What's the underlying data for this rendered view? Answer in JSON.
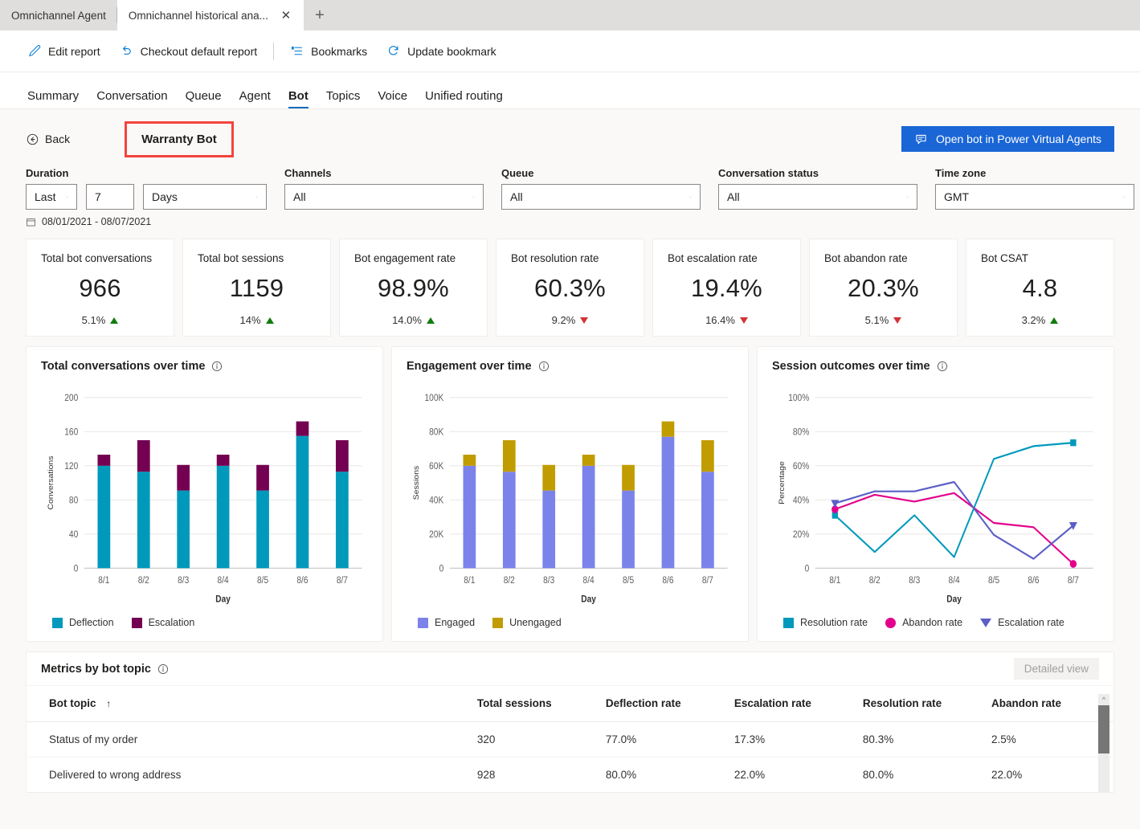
{
  "browser": {
    "tabs": [
      {
        "label": "Omnichannel Agent",
        "active": false
      },
      {
        "label": "Omnichannel historical ana...",
        "active": true
      }
    ],
    "close_glyph": "✕",
    "newtab_glyph": "+"
  },
  "commandbar": {
    "items": [
      {
        "label": "Edit report",
        "icon": "pencil-icon"
      },
      {
        "label": "Checkout default report",
        "icon": "undo-icon"
      },
      {
        "label": "Bookmarks",
        "icon": "bookmarks-list-icon"
      },
      {
        "label": "Update bookmark",
        "icon": "refresh-icon"
      }
    ]
  },
  "pivot": {
    "tabs": [
      "Summary",
      "Conversation",
      "Queue",
      "Agent",
      "Bot",
      "Topics",
      "Voice",
      "Unified routing"
    ],
    "selected": "Bot"
  },
  "header": {
    "back_label": "Back",
    "bot_name": "Warranty Bot",
    "highlight_color": "#f4433e",
    "pva_button_label": "Open bot in Power Virtual Agents",
    "pva_button_color": "#1a66d6"
  },
  "filters": {
    "duration": {
      "label": "Duration",
      "relative": "Last",
      "amount": "7",
      "unit": "Days",
      "range_text": "08/01/2021 - 08/07/2021"
    },
    "channels": {
      "label": "Channels",
      "value": "All"
    },
    "queue": {
      "label": "Queue",
      "value": "All"
    },
    "conversation_status": {
      "label": "Conversation status",
      "value": "All"
    },
    "time_zone": {
      "label": "Time zone",
      "value": "GMT"
    }
  },
  "kpis": [
    {
      "title": "Total bot conversations",
      "value": "966",
      "delta": "5.1%",
      "direction": "up"
    },
    {
      "title": "Total bot sessions",
      "value": "1159",
      "delta": "14%",
      "direction": "up"
    },
    {
      "title": "Bot engagement rate",
      "value": "98.9%",
      "delta": "14.0%",
      "direction": "up"
    },
    {
      "title": "Bot resolution rate",
      "value": "60.3%",
      "delta": "9.2%",
      "direction": "down"
    },
    {
      "title": "Bot escalation rate",
      "value": "19.4%",
      "delta": "16.4%",
      "direction": "down"
    },
    {
      "title": "Bot abandon rate",
      "value": "20.3%",
      "delta": "5.1%",
      "direction": "down"
    },
    {
      "title": "Bot CSAT",
      "value": "4.8",
      "delta": "3.2%",
      "direction": "up"
    }
  ],
  "kpi_colors": {
    "up": "#107c10",
    "down": "#d13438"
  },
  "chart_data": [
    {
      "type": "bar",
      "stacked": true,
      "title": "Total conversations over time",
      "xlabel": "Day",
      "ylabel": "Conversations",
      "categories": [
        "8/1",
        "8/2",
        "8/3",
        "8/4",
        "8/5",
        "8/6",
        "8/7"
      ],
      "ylim": [
        0,
        200
      ],
      "yticks": [
        0,
        40,
        80,
        120,
        160,
        200
      ],
      "ytick_labels": [
        "0",
        "40",
        "80",
        "120",
        "160",
        "200"
      ],
      "grid": true,
      "legend_position": "bottom-left",
      "series": [
        {
          "name": "Deflection",
          "color": "#0099bc",
          "values": [
            120,
            113,
            91,
            120,
            91,
            155,
            113
          ]
        },
        {
          "name": "Escalation",
          "color": "#730051",
          "values": [
            13,
            37,
            30,
            13,
            30,
            17,
            37
          ]
        }
      ]
    },
    {
      "type": "bar",
      "stacked": true,
      "title": "Engagement over time",
      "xlabel": "Day",
      "ylabel": "Sessions",
      "categories": [
        "8/1",
        "8/2",
        "8/3",
        "8/4",
        "8/5",
        "8/6",
        "8/7"
      ],
      "ylim": [
        0,
        100000
      ],
      "yticks": [
        0,
        20000,
        40000,
        60000,
        80000,
        100000
      ],
      "ytick_labels": [
        "0",
        "20K",
        "40K",
        "60K",
        "80K",
        "100K"
      ],
      "grid": true,
      "legend_position": "bottom-left",
      "series": [
        {
          "name": "Engaged",
          "color": "#7b83eb",
          "values": [
            60000,
            56500,
            45500,
            60000,
            45500,
            77000,
            56500
          ]
        },
        {
          "name": "Unengaged",
          "color": "#c19c00",
          "values": [
            6500,
            18500,
            15000,
            6500,
            15000,
            9000,
            18500
          ]
        }
      ]
    },
    {
      "type": "line",
      "title": "Session outcomes over time",
      "xlabel": "Day",
      "ylabel": "Percentage",
      "categories": [
        "8/1",
        "8/2",
        "8/3",
        "8/4",
        "8/5",
        "8/6",
        "8/7"
      ],
      "ylim": [
        0,
        100
      ],
      "yticks": [
        0,
        20,
        40,
        60,
        80,
        100
      ],
      "ytick_labels": [
        "0",
        "20%",
        "40%",
        "60%",
        "80%",
        "100%"
      ],
      "grid": true,
      "legend_position": "bottom-left",
      "series": [
        {
          "name": "Resolution rate",
          "color": "#0099bc",
          "marker": "square",
          "values": [
            31,
            9.5,
            31,
            6.5,
            64,
            71.5,
            73.5
          ]
        },
        {
          "name": "Abandon rate",
          "color": "#e3008c",
          "marker": "circle",
          "values": [
            34.5,
            43,
            39,
            44,
            26.5,
            24,
            2.5
          ]
        },
        {
          "name": "Escalation rate",
          "color": "#5b5fc7",
          "marker": "triangle",
          "values": [
            38,
            45,
            45,
            50.5,
            19.5,
            5.5,
            25
          ]
        }
      ]
    }
  ],
  "table": {
    "title": "Metrics by bot topic",
    "detailed_view_label": "Detailed view",
    "sort_column": "Bot topic",
    "sort_glyph": "↑",
    "columns": [
      "Bot topic",
      "Total sessions",
      "Deflection rate",
      "Escalation rate",
      "Resolution rate",
      "Abandon rate"
    ],
    "rows": [
      {
        "topic": "Status of my order",
        "total_sessions": "320",
        "deflection_rate": "77.0%",
        "escalation_rate": "17.3%",
        "resolution_rate": "80.3%",
        "abandon_rate": "2.5%"
      },
      {
        "topic": "Delivered to wrong address",
        "total_sessions": "928",
        "deflection_rate": "80.0%",
        "escalation_rate": "22.0%",
        "resolution_rate": "80.0%",
        "abandon_rate": "22.0%"
      }
    ]
  }
}
